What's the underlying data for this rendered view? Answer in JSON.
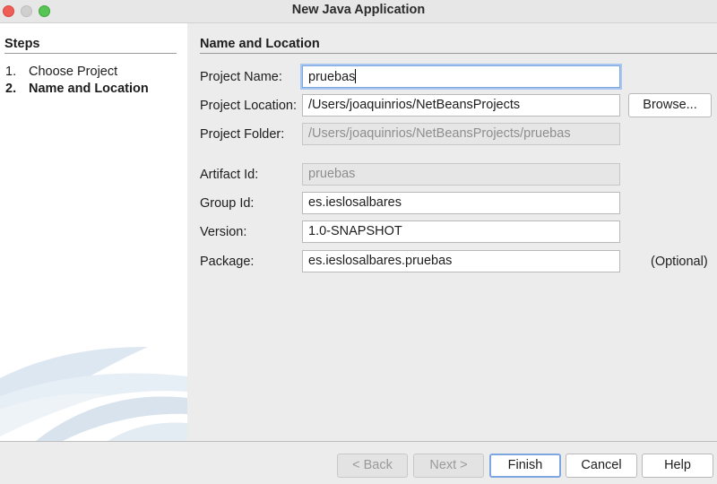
{
  "window": {
    "title": "New Java Application"
  },
  "steps": {
    "heading": "Steps",
    "items": [
      {
        "number": "1.",
        "label": "Choose Project",
        "current": false
      },
      {
        "number": "2.",
        "label": "Name and Location",
        "current": true
      }
    ]
  },
  "form": {
    "heading": "Name and Location",
    "project_name": {
      "label": "Project Name:",
      "value": "pruebas"
    },
    "project_location": {
      "label": "Project Location:",
      "value": "/Users/joaquinrios/NetBeansProjects",
      "browse_label": "Browse..."
    },
    "project_folder": {
      "label": "Project Folder:",
      "value": "/Users/joaquinrios/NetBeansProjects/pruebas"
    },
    "artifact_id": {
      "label": "Artifact Id:",
      "value": "pruebas"
    },
    "group_id": {
      "label": "Group Id:",
      "value": "es.ieslosalbares"
    },
    "version": {
      "label": "Version:",
      "value": "1.0-SNAPSHOT"
    },
    "package": {
      "label": "Package:",
      "value": "es.ieslosalbares.pruebas",
      "note": "(Optional)"
    }
  },
  "buttons": {
    "back": "< Back",
    "next": "Next >",
    "finish": "Finish",
    "cancel": "Cancel",
    "help": "Help"
  },
  "colors": {
    "focus_ring": "#7fa7e0",
    "close": "#ee5e57",
    "zoom": "#57c454"
  }
}
